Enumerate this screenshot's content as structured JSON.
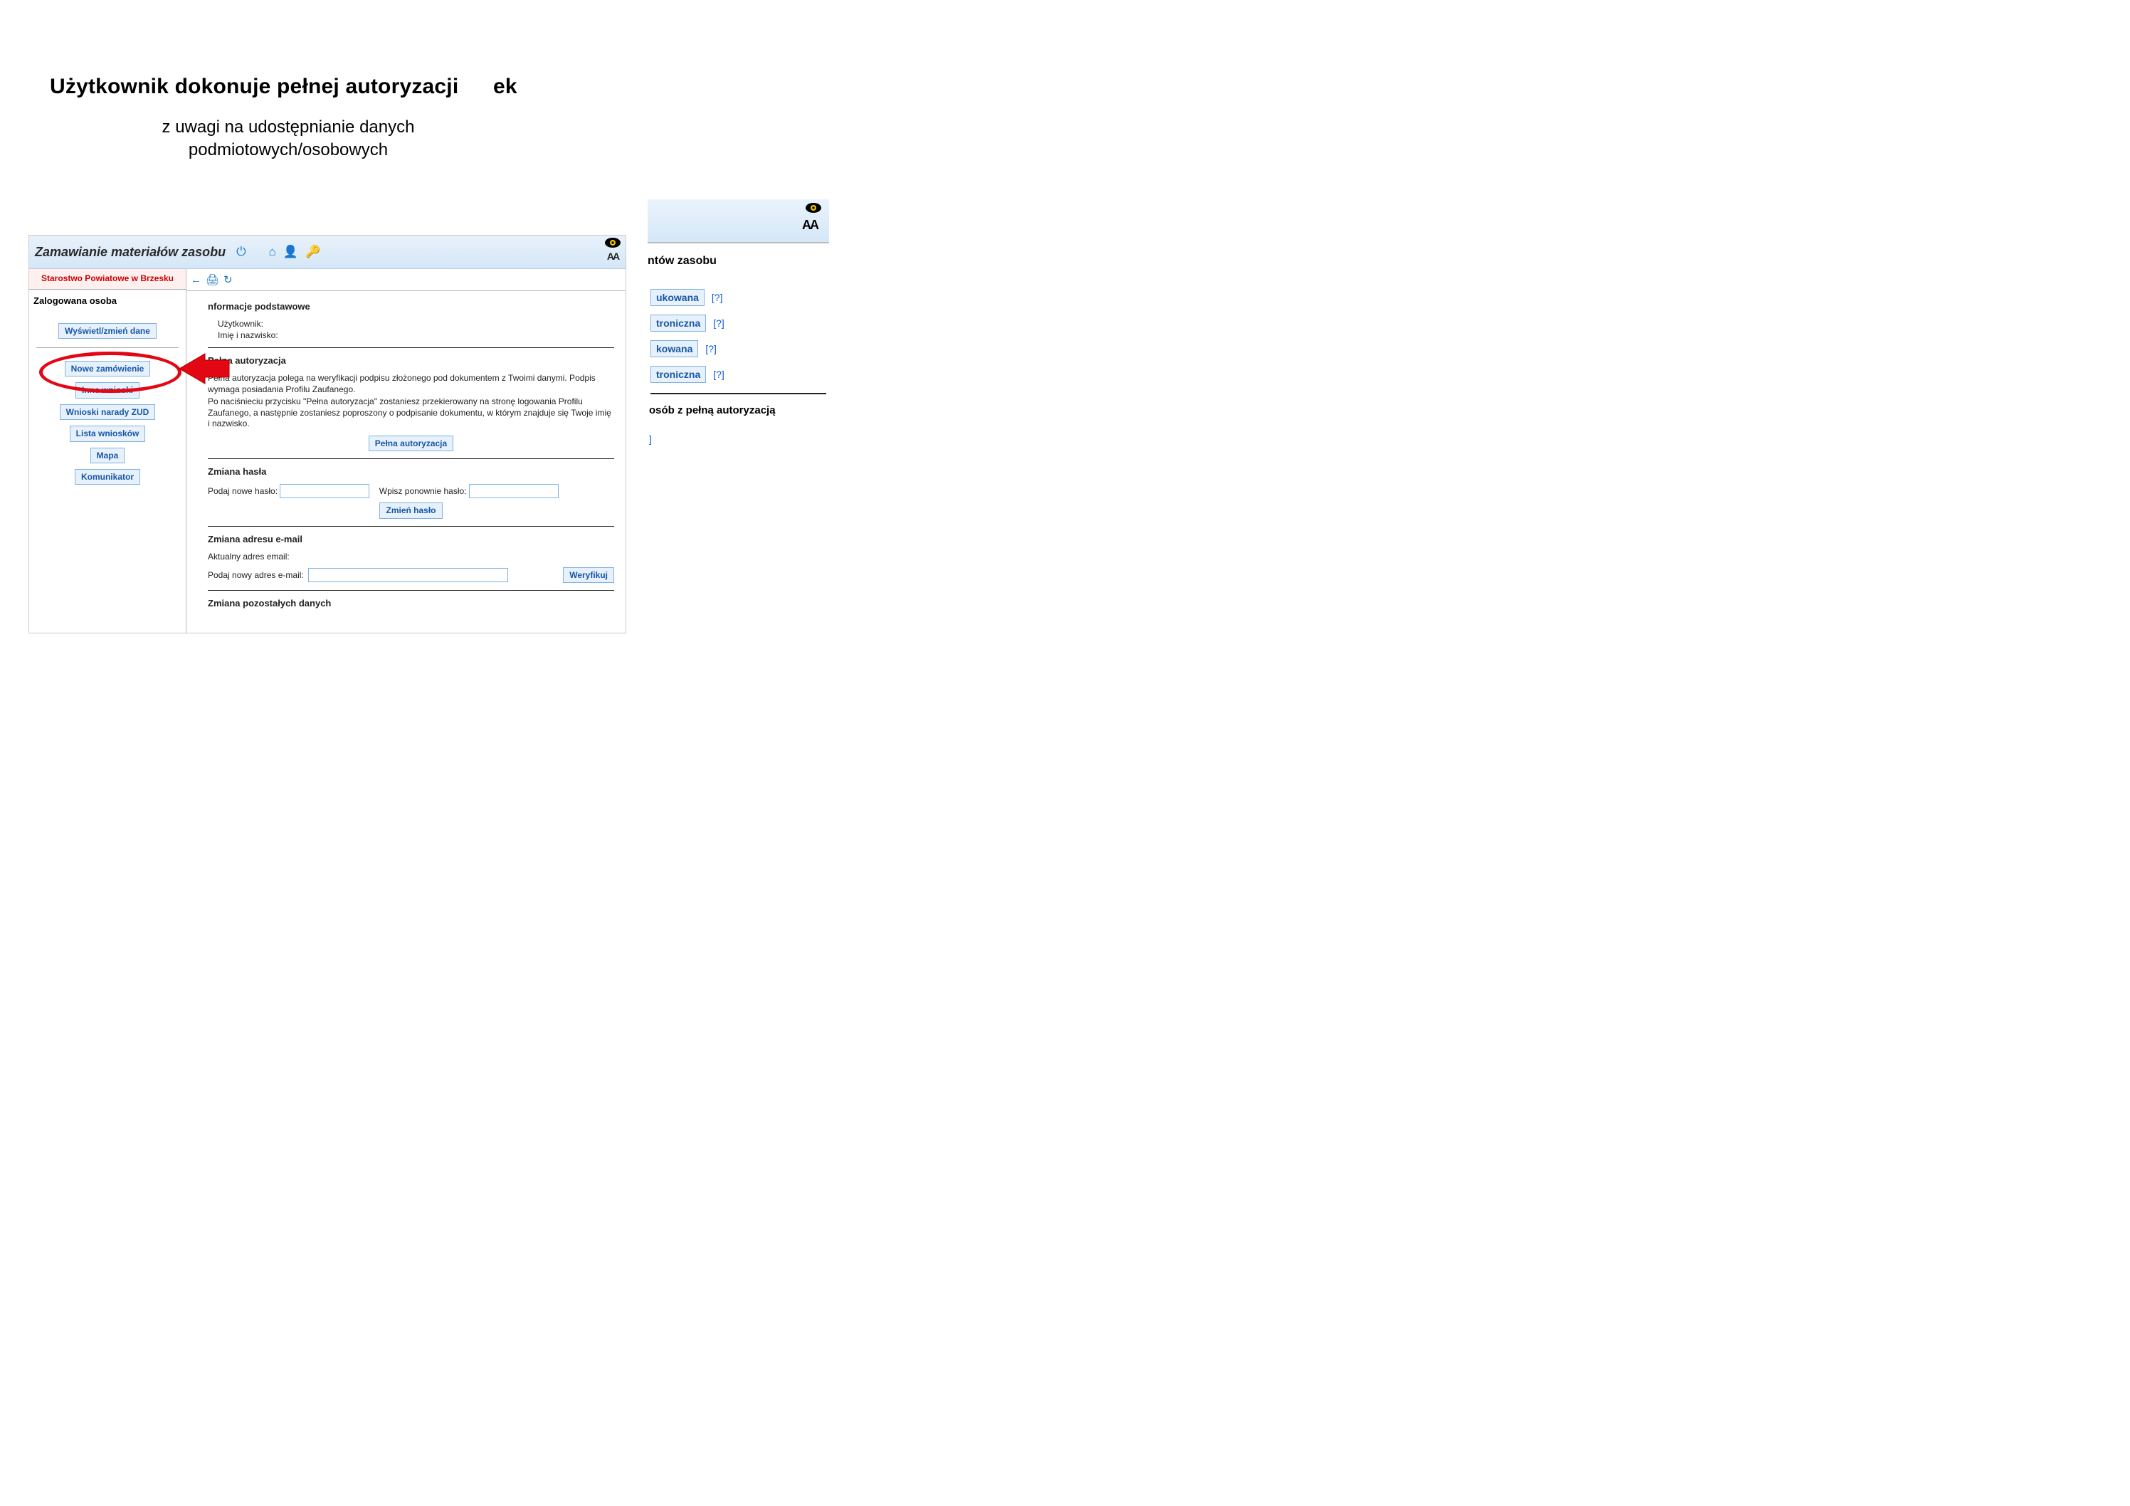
{
  "slide": {
    "title_main": "Użytkownik dokonuje pełnej autoryzacji",
    "title_frag": "ek",
    "subtitle_line1": "z uwagi na udostępnianie danych",
    "subtitle_line2": "podmiotowych/osobowych"
  },
  "app": {
    "title": "Zamawianie materiałów zasobu",
    "office": "Starostwo Powiatowe w Brzesku",
    "logged_label": "Zalogowana osoba",
    "view_change_label": "Wyświetl/zmień dane",
    "menu": {
      "new_order": "Nowe zamówienie",
      "other_requests": "Inne wnioski",
      "zud": "Wnioski narady ZUD",
      "list": "Lista wniosków",
      "map": "Mapa",
      "comm": "Komunikator"
    }
  },
  "main": {
    "basic_header": "nformacje podstawowe",
    "user_label": "Użytkownik:",
    "name_label": "Imię i nazwisko:",
    "auth_header": "Pełna autoryzacja",
    "auth_desc1": "Pełna autoryzacja polega na weryfikacji podpisu złożonego pod dokumentem z Twoimi danymi. Podpis wymaga posiadania Profilu Zaufanego.",
    "auth_desc2": "Po naciśnieciu przycisku \"Pełna autoryzacja\" zostaniesz przekierowany na stronę logowania Profilu Zaufanego, a następnie zostaniesz poproszony o podpisanie dokumentu, w którym znajduje się Twoje imię i nazwisko.",
    "auth_button": "Pełna autoryzacja",
    "passwd_header": "Zmiana hasła",
    "passwd_new_label": "Podaj nowe hasło:",
    "passwd_repeat_label": "Wpisz ponownie hasło:",
    "passwd_button": "Zmień hasło",
    "email_header": "Zmiana adresu e-mail",
    "email_current_label": "Aktualny adres email:",
    "email_new_label": "Podaj nowy adres e-mail:",
    "email_verify_button": "Weryfikuj",
    "other_header": "Zmiana pozostałych danych"
  },
  "shot2": {
    "headline": "ntów zasobu",
    "items": {
      "a": "ukowana",
      "b": "troniczna",
      "c": "kowana",
      "d": "troniczna"
    },
    "help": "[?]",
    "subheader": "osób z pełną autoryzacją",
    "bracket": "]"
  },
  "a11y": {
    "AA": "AA"
  }
}
